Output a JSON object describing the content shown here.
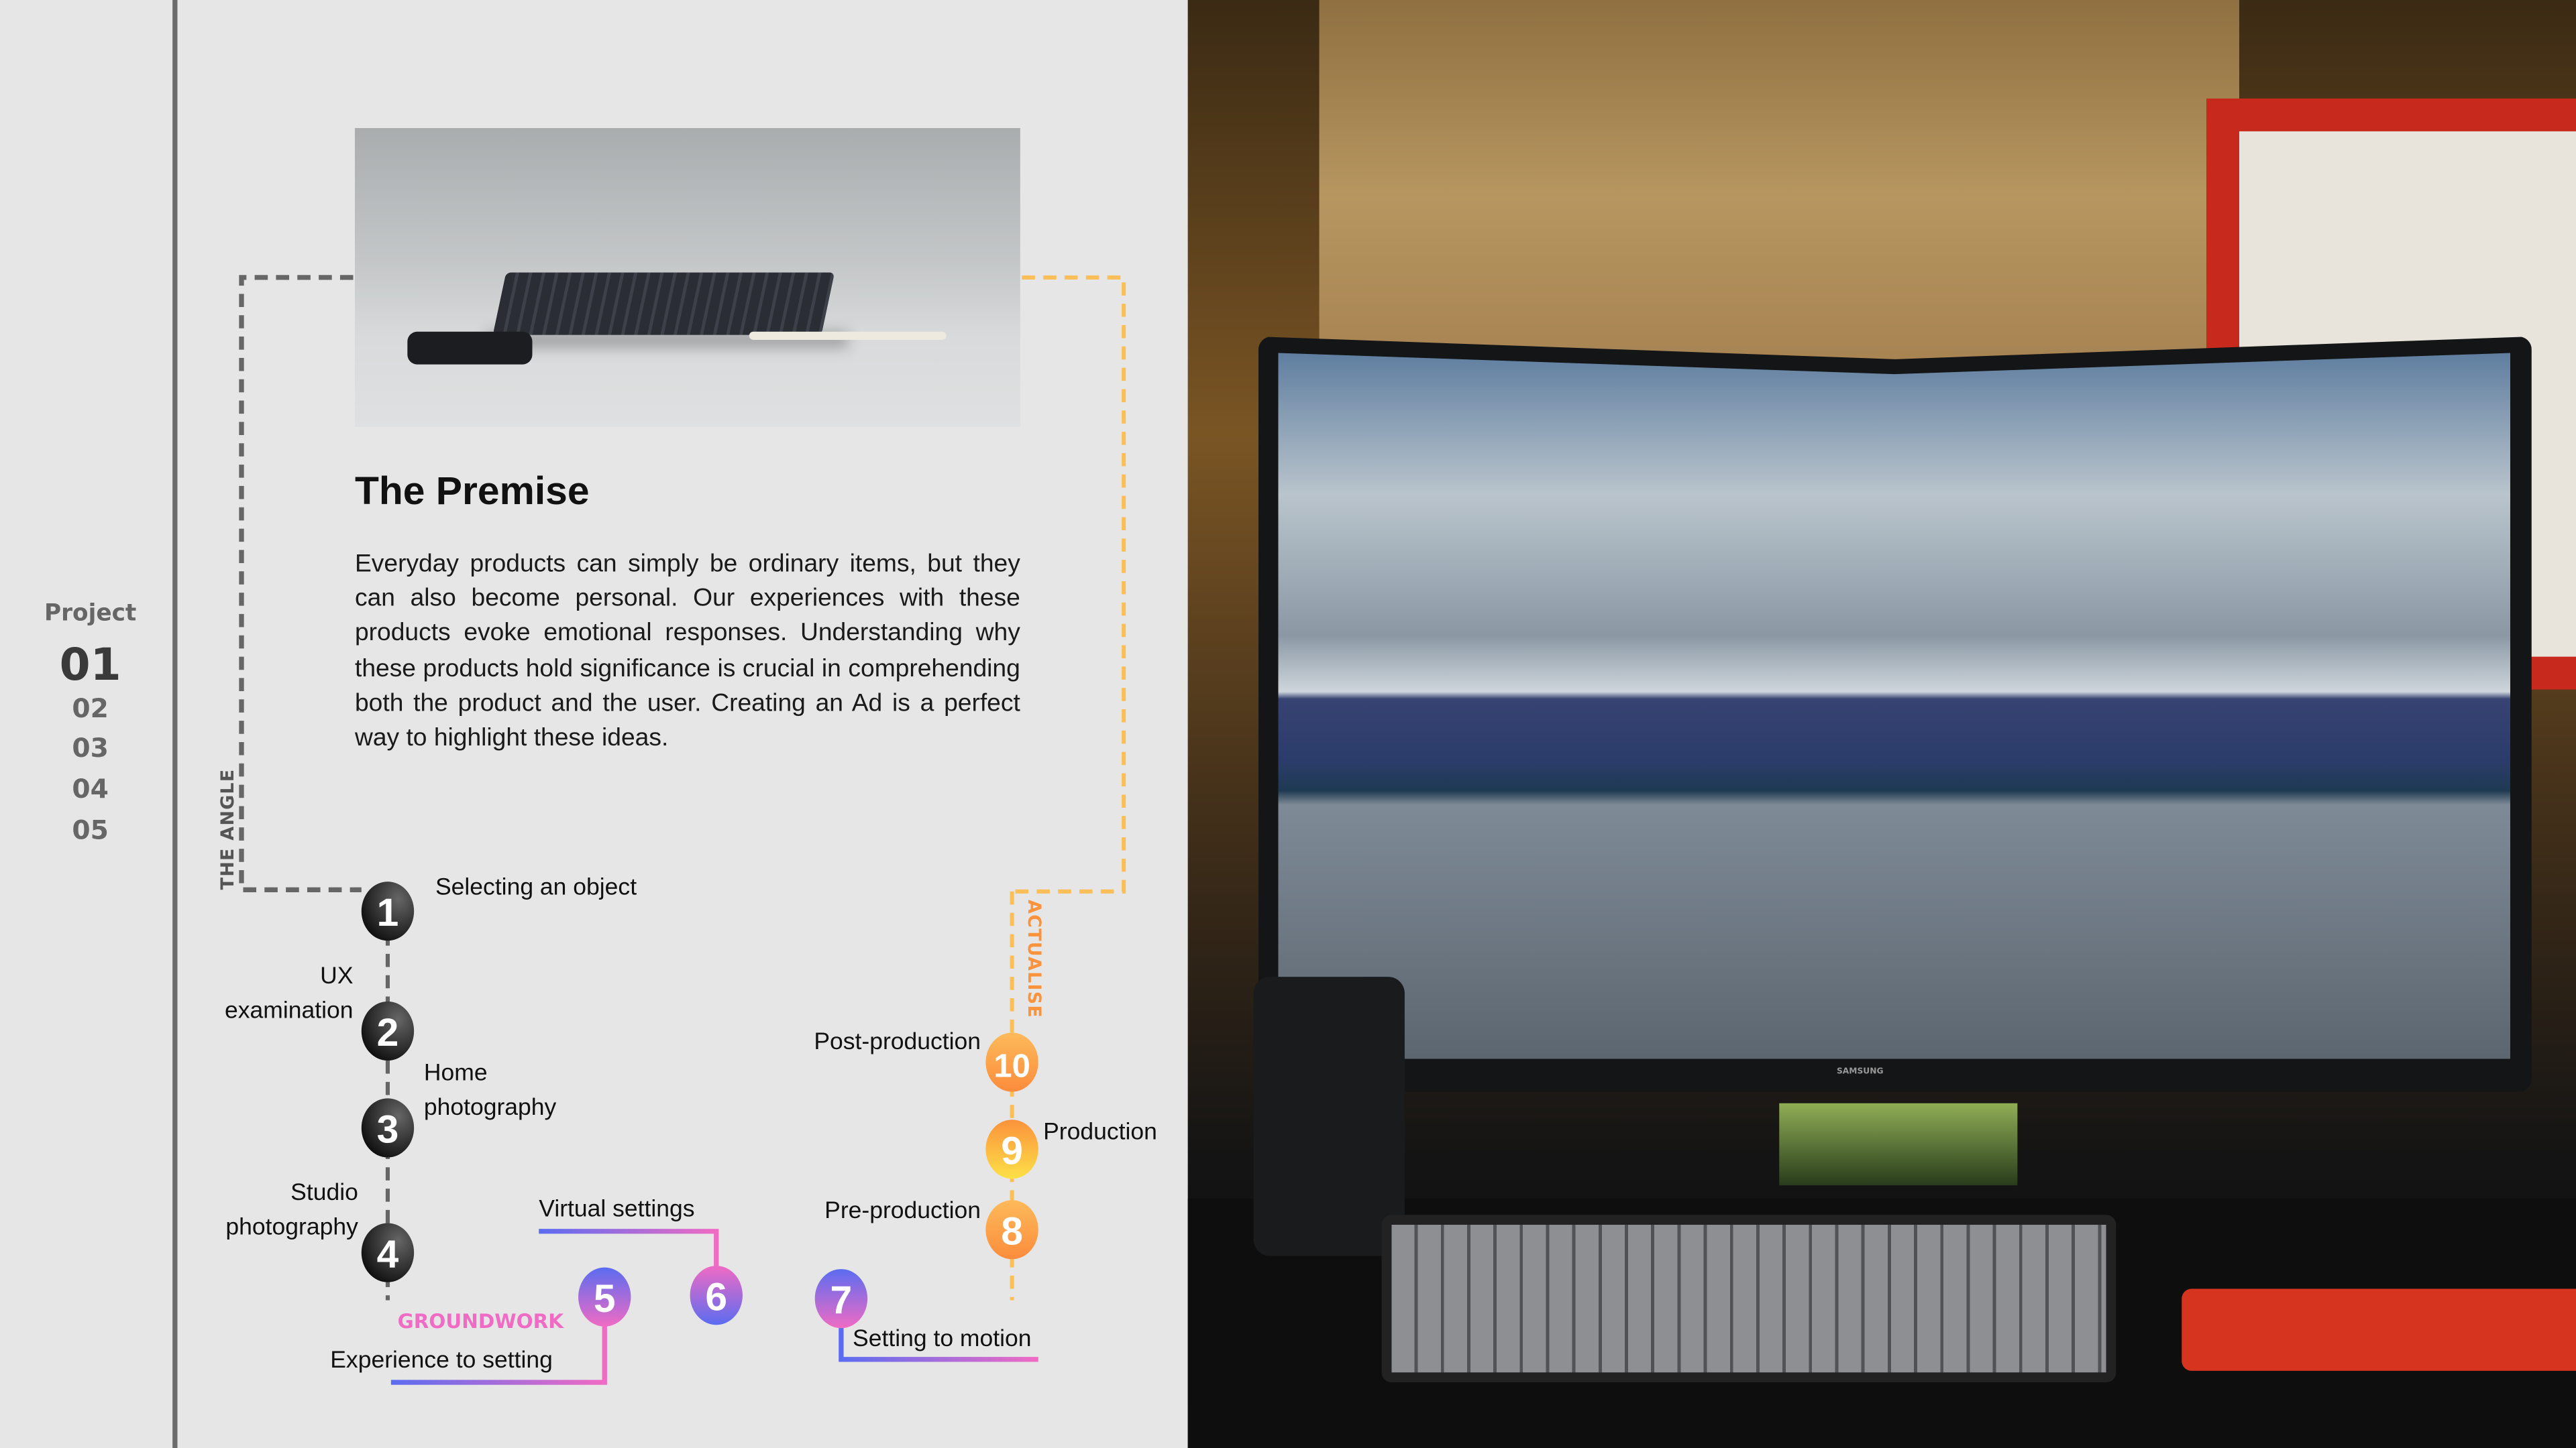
{
  "nav": {
    "title": "Project",
    "items": [
      {
        "label": "01",
        "active": true
      },
      {
        "label": "02",
        "active": false
      },
      {
        "label": "03",
        "active": false
      },
      {
        "label": "04",
        "active": false
      },
      {
        "label": "05",
        "active": false
      }
    ]
  },
  "premise": {
    "title": "The Premise",
    "body": "Everyday products can simply be ordinary items, but they can also become personal. Our experiences with these products evoke emotional responses. Understanding why these products hold significance is crucial in comprehending both the product and the user. Creating an Ad is a perfect way to highlight these ideas."
  },
  "phases": {
    "angle": "THE ANGLE",
    "groundwork": "GROUNDWORK",
    "actualise": "ACTUALISE"
  },
  "steps": [
    {
      "number": "1",
      "label": "Selecting an object"
    },
    {
      "number": "2",
      "label_line1": "UX",
      "label_line2": "examination"
    },
    {
      "number": "3",
      "label_line1": "Home",
      "label_line2": "photography"
    },
    {
      "number": "4",
      "label_line1": "Studio",
      "label_line2": "photography"
    },
    {
      "number": "5",
      "label": "Experience to setting"
    },
    {
      "number": "6",
      "label": "Virtual settings"
    },
    {
      "number": "7",
      "label": "Setting to motion"
    },
    {
      "number": "8",
      "label": "Pre-production"
    },
    {
      "number": "9",
      "label": "Production"
    },
    {
      "number": "10",
      "label": "Post-production"
    }
  ],
  "photo": {
    "monitor_brand": "SAMSUNG"
  },
  "colors": {
    "background": "#e6e6e6",
    "angle_gray": "#666666",
    "groundwork_pink": "#f06bc4",
    "groundwork_blue": "#5b6cf0",
    "actualise_orange": "#fb923c",
    "actualise_yellow": "#fcd34d"
  }
}
